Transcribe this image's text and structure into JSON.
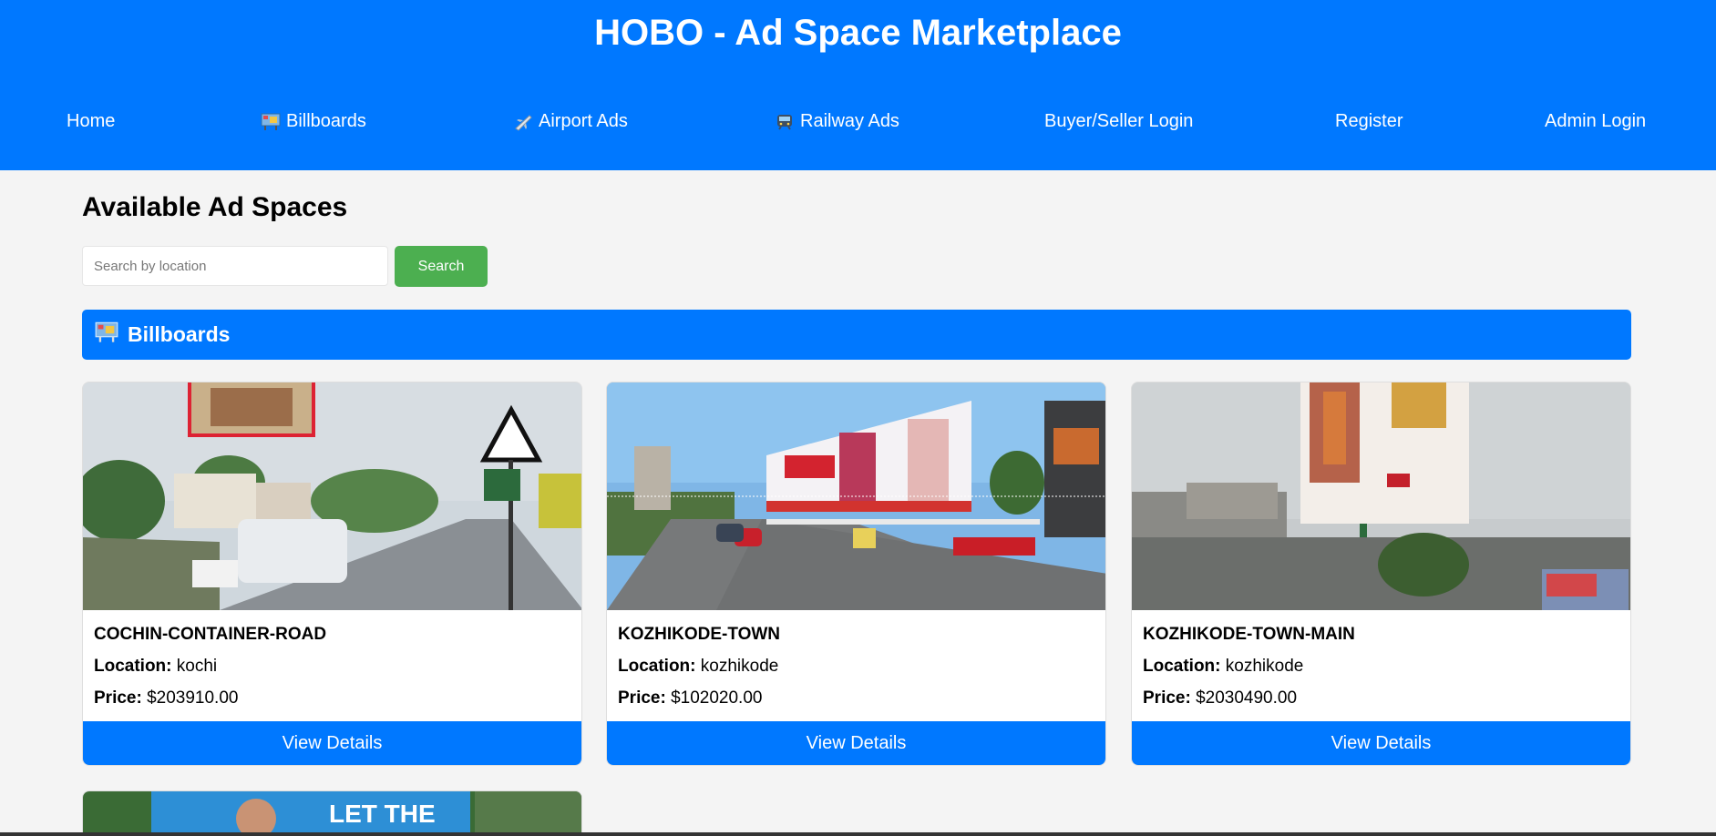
{
  "header": {
    "title": "HOBO - Ad Space Marketplace"
  },
  "nav": [
    {
      "label": "Home",
      "icon": ""
    },
    {
      "label": "Billboards",
      "icon": "billboard-icon"
    },
    {
      "label": "Airport Ads",
      "icon": "airplane-icon"
    },
    {
      "label": "Railway Ads",
      "icon": "train-icon"
    },
    {
      "label": "Buyer/Seller Login",
      "icon": ""
    },
    {
      "label": "Register",
      "icon": ""
    },
    {
      "label": "Admin Login",
      "icon": ""
    }
  ],
  "main": {
    "heading": "Available Ad Spaces",
    "search": {
      "placeholder": "Search by location",
      "value": "",
      "button_label": "Search"
    },
    "section": {
      "label": "Billboards",
      "icon": "billboard-icon"
    }
  },
  "labels": {
    "location": "Location:",
    "price": "Price:"
  },
  "cards": [
    {
      "title": "COCHIN-CONTAINER-ROAD",
      "location": "kochi",
      "price": "$203910.00",
      "button": "View Details"
    },
    {
      "title": "KOZHIKODE-TOWN",
      "location": "kozhikode",
      "price": "$102020.00",
      "button": "View Details"
    },
    {
      "title": "KOZHIKODE-TOWN-MAIN",
      "location": "kozhikode",
      "price": "$2030490.00",
      "button": "View Details"
    }
  ],
  "partial_card": {
    "visible_text": "LET THE"
  },
  "colors": {
    "primary": "#0078ff",
    "search_button": "#4caf50",
    "background": "#f4f4f4"
  }
}
